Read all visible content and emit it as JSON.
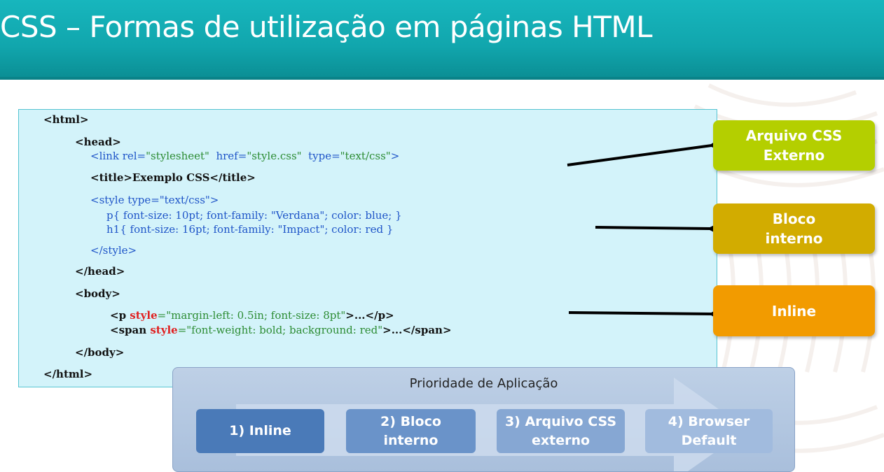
{
  "title": "CSS – Formas de utilização em páginas HTML",
  "code": {
    "html_open": "<html>",
    "head_open": "<head>",
    "link_open": "<link ",
    "link_rel_attr": "rel=",
    "link_rel_val": "\"stylesheet\"",
    "link_href_attr": "  href=",
    "link_href_val": "\"style.css\"",
    "link_type_attr": "  type=",
    "link_type_val": "\"text/css\"",
    "link_close": ">",
    "title_line": "<title>Exemplo CSS</title>",
    "style_open": "<style type=\"text/css\">",
    "rule_p": "p{ font-size: 10pt; font-family: \"Verdana\"; color: blue; }",
    "rule_h1": "h1{ font-size: 16pt; font-family: \"Impact\"; color: red }",
    "style_close": "</style>",
    "head_close": "</head>",
    "body_open": "<body>",
    "p_open": "<p ",
    "p_style_attr": "style",
    "p_style_val": "=\"margin-left: 0.5in; font-size: 8pt\"",
    "p_rest": ">...</p>",
    "span_open": "<span ",
    "span_style_attr": "style",
    "span_style_val": "=\"font-weight: bold; background: red\"",
    "span_rest": ">...</span>",
    "body_close": "</body>",
    "html_close": "</html>"
  },
  "labels": {
    "externo_line1": "Arquivo CSS",
    "externo_line2": "Externo",
    "bloco_line1": "Bloco",
    "bloco_line2": "interno",
    "inline": "Inline"
  },
  "priority": {
    "title": "Prioridade de Aplicação",
    "steps": [
      {
        "line1": "1) Inline",
        "line2": ""
      },
      {
        "line1": "2) Bloco",
        "line2": "interno"
      },
      {
        "line1": "3) Arquivo CSS",
        "line2": "externo"
      },
      {
        "line1": "4) Browser",
        "line2": "Default"
      }
    ]
  },
  "colors": {
    "header": "#11a6ad",
    "code_panel": "#d3f3fa",
    "box_externo": "#b4cf00",
    "box_bloco": "#d2ac00",
    "box_inline": "#f29b00",
    "priority_panel": "#aec3df"
  }
}
